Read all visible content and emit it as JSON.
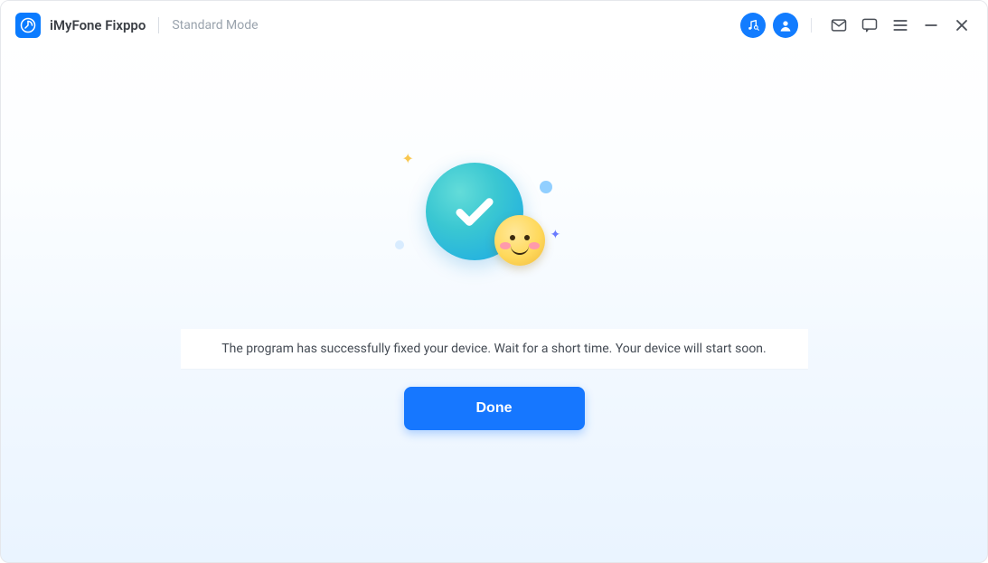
{
  "titlebar": {
    "app_name": "iMyFone Fixppo",
    "mode": "Standard Mode",
    "icons": {
      "music_search": "music-search-icon",
      "account": "account-icon",
      "mail": "mail-icon",
      "feedback": "feedback-icon",
      "menu": "menu-icon",
      "minimize": "minimize-icon",
      "close": "close-icon"
    }
  },
  "main": {
    "status_message": "The program has successfully fixed your device. Wait for a short time. Your device will start soon.",
    "done_label": "Done"
  },
  "colors": {
    "primary": "#1677ff",
    "accent_blue": "#127cff",
    "text_muted": "#9aa3ad"
  }
}
